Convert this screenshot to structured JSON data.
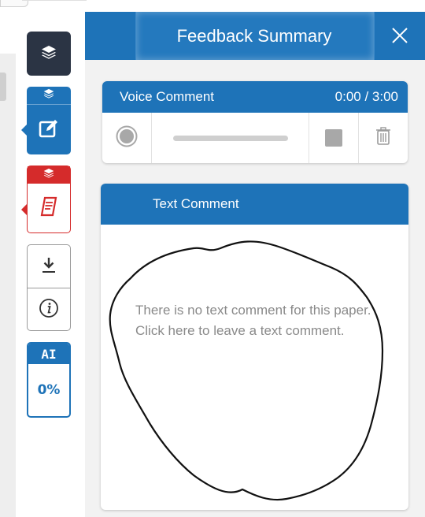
{
  "panel": {
    "title": "Feedback Summary"
  },
  "toolbar": {
    "ai_label": "AI",
    "ai_percent": "0%"
  },
  "voice_comment": {
    "label": "Voice Comment",
    "timer": "0:00 / 3:00"
  },
  "text_comment": {
    "label": "Text Comment",
    "placeholder": "There is no text comment for this paper. Click here to leave a text comment."
  },
  "colors": {
    "primary_blue": "#1e73b8",
    "dark_navy": "#2b3444",
    "alert_red": "#d52b2b"
  },
  "icons": [
    "layers-icon",
    "edit-icon",
    "document-icon",
    "download-icon",
    "info-icon",
    "close-icon",
    "record-icon",
    "stop-icon",
    "trash-icon"
  ]
}
